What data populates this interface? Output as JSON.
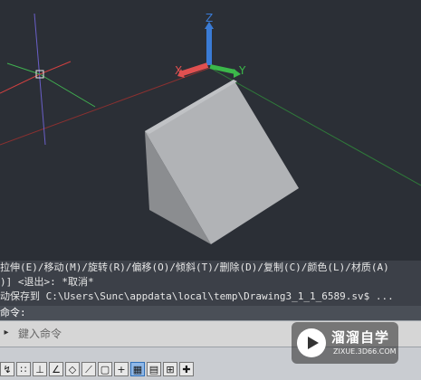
{
  "viewport": {
    "ucs_axis_labels": {
      "x": "X",
      "y": "Y",
      "z": "Z"
    },
    "colors": {
      "background": "#2b2f36",
      "solid_face_front": "#a6a8ab",
      "solid_face_slope": "#b1b3b6",
      "solid_face_side": "#8b8d90",
      "x_axis": "#e05050",
      "y_axis": "#3bb84a",
      "z_axis": "#3a7bd5"
    }
  },
  "command_history": {
    "lines": [
      "拉伸(E)/移动(M)/旋转(R)/偏移(O)/倾斜(T)/删除(D)/复制(C)/颜色(L)/材质(A)",
      ")] <退出>: *取消*",
      "动保存到 C:\\Users\\Sunc\\appdata\\local\\temp\\Drawing3_1_1_6589.sv$ ..."
    ]
  },
  "command_prompt": {
    "text": "命令:"
  },
  "command_input": {
    "placeholder": "鍵入命令"
  },
  "watermark": {
    "title": "溜溜自学",
    "url": "ZIXUE.3D66.COM"
  }
}
